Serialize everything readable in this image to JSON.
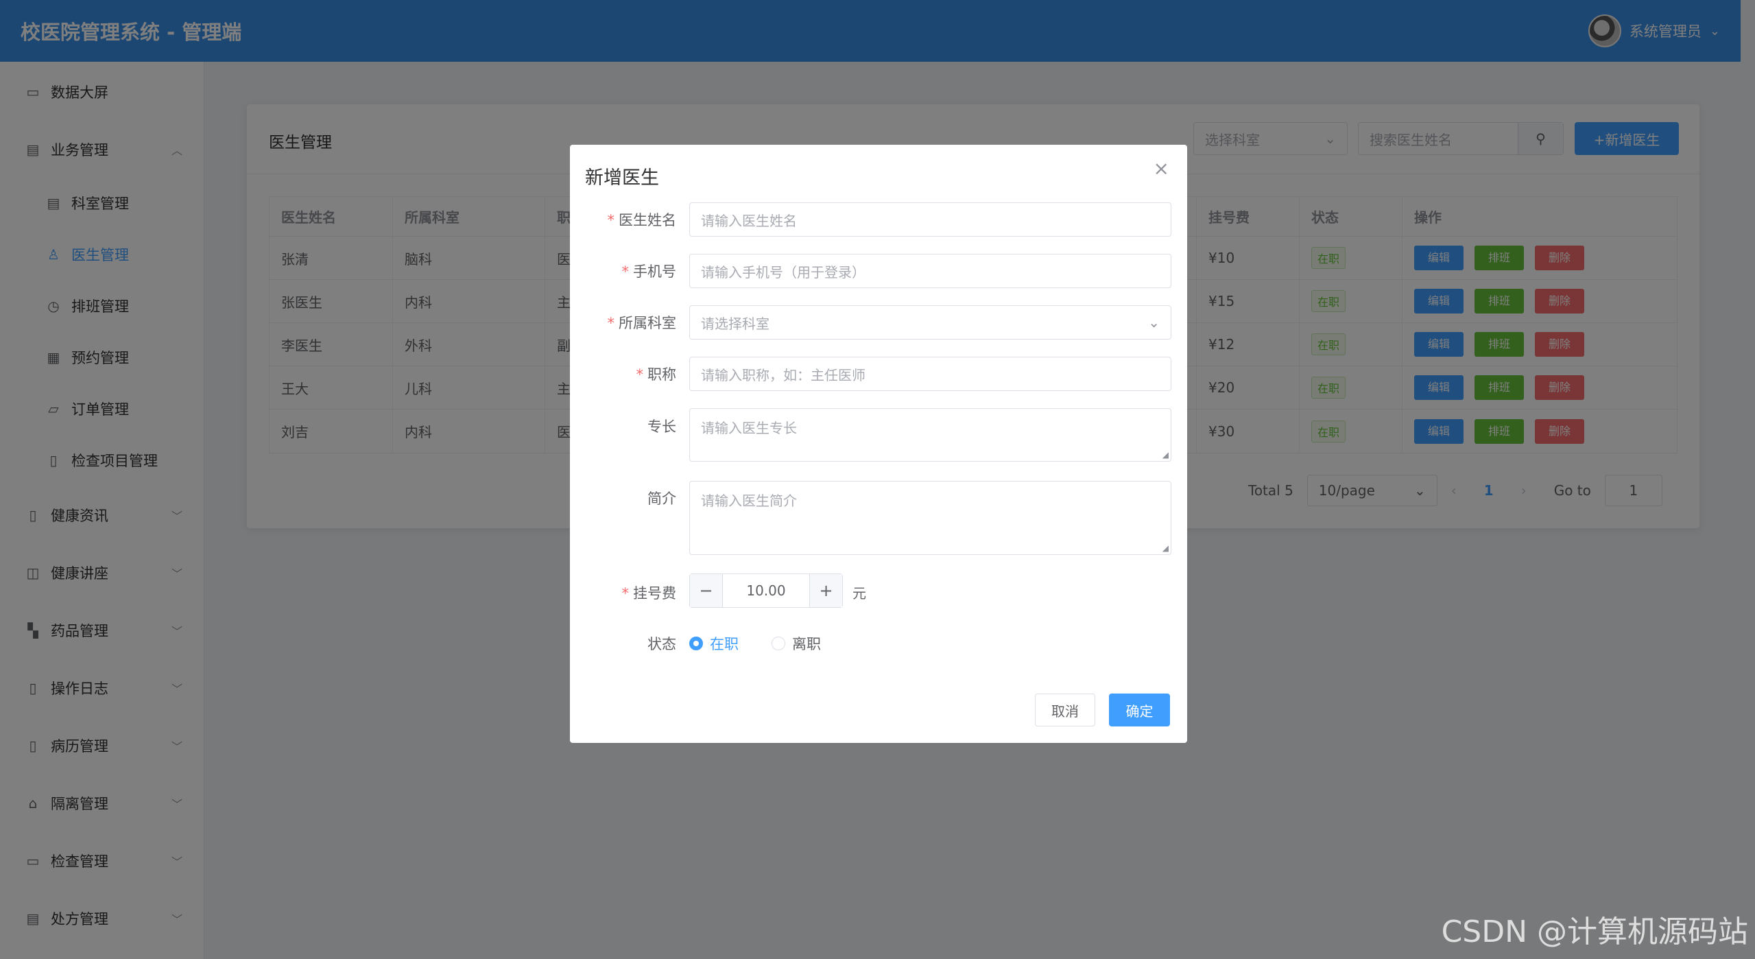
{
  "header": {
    "title": "校医院管理系统 - 管理端",
    "user": "系统管理员"
  },
  "sidebar": {
    "items": [
      {
        "label": "数据大屏",
        "icon": "presentation-icon"
      },
      {
        "label": "业务管理",
        "icon": "building-icon"
      },
      {
        "label": "科室管理",
        "icon": "building-icon"
      },
      {
        "label": "医生管理",
        "icon": "user-icon"
      },
      {
        "label": "排班管理",
        "icon": "clock-icon"
      },
      {
        "label": "预约管理",
        "icon": "calendar-icon"
      },
      {
        "label": "订单管理",
        "icon": "folder-icon"
      },
      {
        "label": "检查项目管理",
        "icon": "document-icon"
      },
      {
        "label": "健康资讯",
        "icon": "document-icon"
      },
      {
        "label": "健康讲座",
        "icon": "book-icon"
      },
      {
        "label": "药品管理",
        "icon": "grid-icon"
      },
      {
        "label": "操作日志",
        "icon": "document-icon"
      },
      {
        "label": "病历管理",
        "icon": "document-icon"
      },
      {
        "label": "隔离管理",
        "icon": "house-icon"
      },
      {
        "label": "检查管理",
        "icon": "monitor-icon"
      },
      {
        "label": "处方管理",
        "icon": "tickets-icon"
      }
    ]
  },
  "card": {
    "title": "医生管理",
    "filter_placeholder": "选择科室",
    "search_placeholder": "搜索医生姓名",
    "add_label": "+新增医生"
  },
  "table": {
    "columns": [
      "医生姓名",
      "所属科室",
      "职",
      "挂号费",
      "状态",
      "操作"
    ],
    "rows": [
      {
        "name": "张清",
        "dept": "脑科",
        "title": "医",
        "fee": "¥10",
        "status": "在职"
      },
      {
        "name": "张医生",
        "dept": "内科",
        "title": "主",
        "fee": "¥15",
        "status": "在职"
      },
      {
        "name": "李医生",
        "dept": "外科",
        "title": "副",
        "fee": "¥12",
        "status": "在职"
      },
      {
        "name": "王大",
        "dept": "儿科",
        "title": "主",
        "fee": "¥20",
        "status": "在职"
      },
      {
        "name": "刘吉",
        "dept": "内科",
        "title": "医",
        "fee": "¥30",
        "status": "在职"
      }
    ],
    "actions": {
      "edit": "编辑",
      "schedule": "排班",
      "delete": "删除"
    }
  },
  "pager": {
    "total": "Total 5",
    "size": "10/page",
    "current": "1",
    "goto_label": "Go to",
    "goto_value": "1"
  },
  "dialog": {
    "title": "新增医生",
    "name_label": "医生姓名",
    "name_placeholder": "请输入医生姓名",
    "phone_label": "手机号",
    "phone_placeholder": "请输入手机号（用于登录）",
    "dept_label": "所属科室",
    "dept_placeholder": "请选择科室",
    "title_label": "职称",
    "title_placeholder": "请输入职称，如：主任医师",
    "specialty_label": "专长",
    "specialty_placeholder": "请输入医生专长",
    "intro_label": "简介",
    "intro_placeholder": "请输入医生简介",
    "fee_label": "挂号费",
    "fee_value": "10.00",
    "fee_unit": "元",
    "status_label": "状态",
    "status_on": "在职",
    "status_off": "离职",
    "cancel": "取消",
    "confirm": "确定"
  },
  "watermark": "CSDN @计算机源码站",
  "colors": {
    "primary": "#409eff",
    "success": "#67c23a",
    "danger": "#f56c6c",
    "header": "#3a8ee6"
  }
}
